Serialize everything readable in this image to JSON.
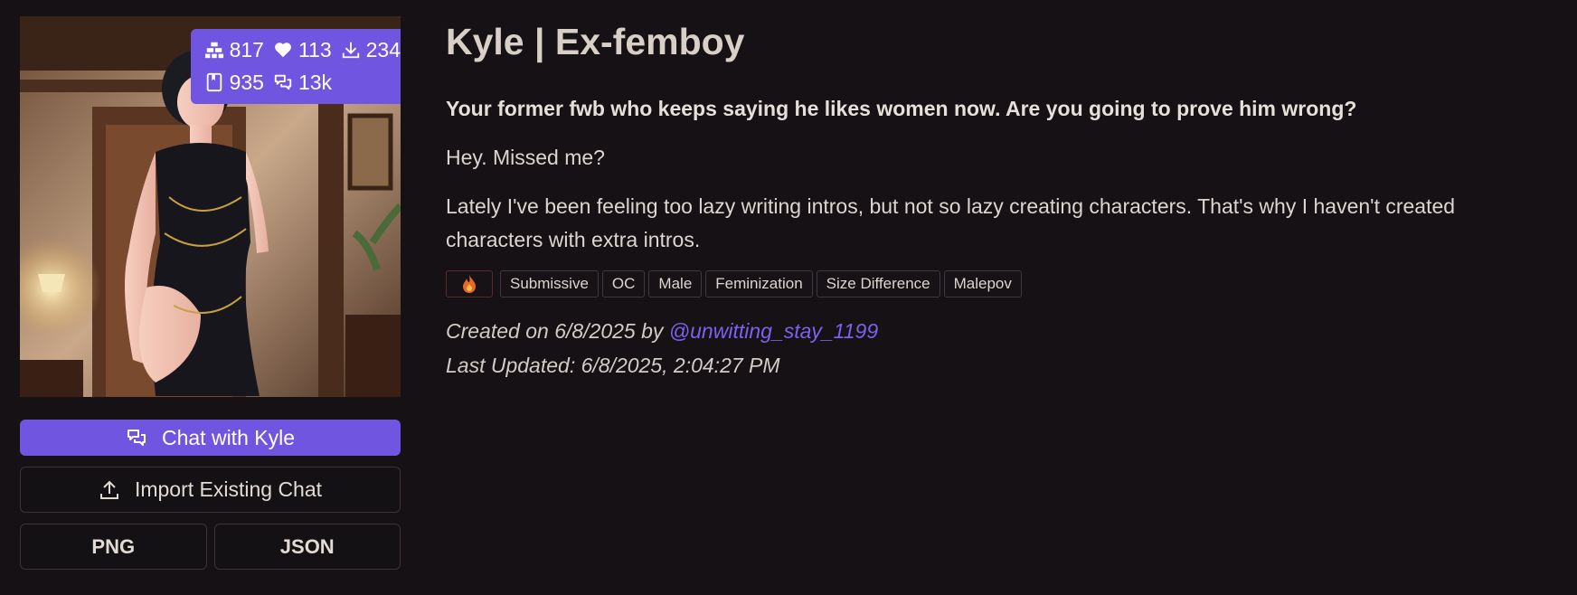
{
  "stats": {
    "tokens": "817",
    "favorites": "113",
    "downloads": "234",
    "messages": "935",
    "chats": "13k"
  },
  "buttons": {
    "chat": "Chat with Kyle",
    "import": "Import Existing Chat",
    "png": "PNG",
    "json": "JSON"
  },
  "character": {
    "title": "Kyle | Ex-femboy",
    "tagline": "Your former fwb who keeps saying he likes women now. Are you going to prove him wrong?",
    "greeting": "Hey. Missed me?",
    "description": "Lately I've been feeling too lazy writing intros, but not so lazy creating characters. That's why I haven't created characters with extra intros."
  },
  "tags": [
    "Submissive",
    "OC",
    "Male",
    "Feminization",
    "Size Difference",
    "Malepov"
  ],
  "meta": {
    "created_prefix": "Created on 6/8/2025 by",
    "creator": "@unwitting_stay_1199",
    "updated": "Last Updated: 6/8/2025, 2:04:27 PM"
  },
  "colors": {
    "accent": "#6f55e0",
    "link": "#7a62f0",
    "background": "#151115",
    "nsfw_border": "#5a2a2a"
  },
  "icons": {
    "tokens": "pyramid-icon",
    "favorites": "heart-icon",
    "downloads": "download-icon",
    "messages": "book-icon",
    "chats": "chat-bubbles-icon",
    "nsfw": "fire-icon",
    "import": "upload-icon"
  }
}
